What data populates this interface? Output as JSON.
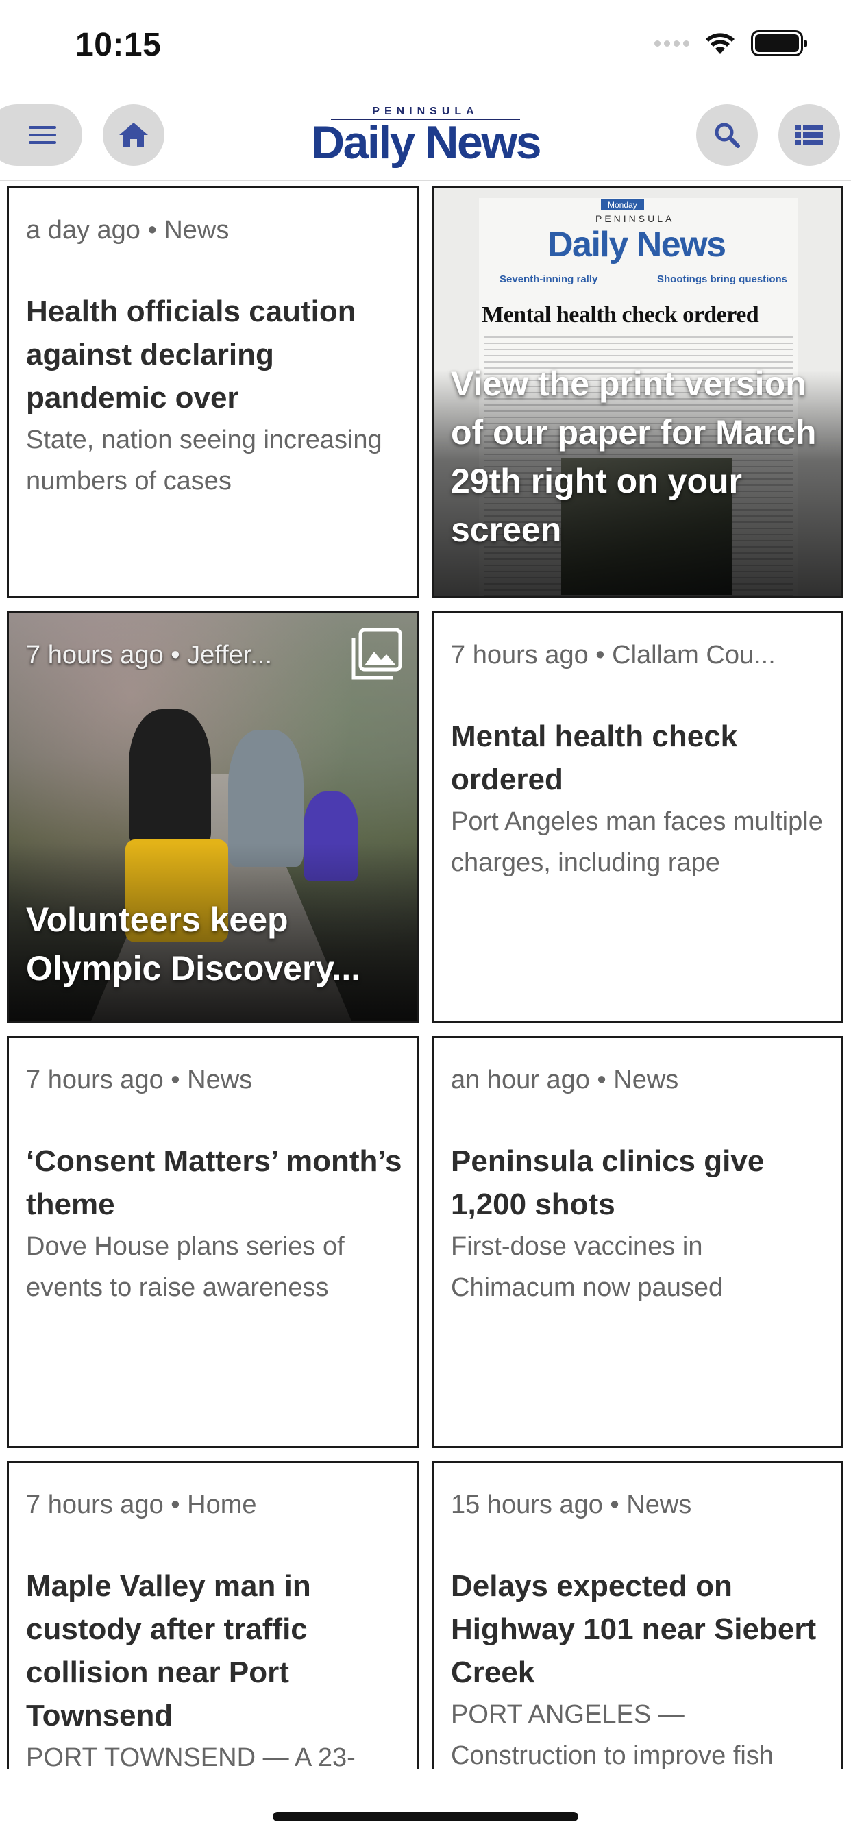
{
  "status_bar": {
    "time": "10:15"
  },
  "header": {
    "logo_top": "PENINSULA",
    "logo_main": "Daily News",
    "menu_icon": "hamburger-menu-icon",
    "home_icon": "home-icon",
    "search_icon": "search-icon",
    "sections_icon": "list-icon"
  },
  "colors": {
    "brand": "#1e3c8c",
    "icon_bg": "#d9d9d9",
    "icon_fg": "#3a4fa0",
    "card_border": "#1a1a1a"
  },
  "cards": [
    {
      "meta": "a day ago • News",
      "headline": "Health officials caution against declaring pandemic over",
      "deck": "State, nation seeing increasing numbers of cases"
    },
    {
      "overlay": "View the print version of our paper for March 29th right on your screen",
      "paper": {
        "kicker": "Monday",
        "sub": "PENINSULA",
        "logo": "Daily News",
        "headline": "Mental health check ordered",
        "teaser_left": "Seventh-inning rally",
        "teaser_right": "Shootings bring questions"
      }
    },
    {
      "meta": "7 hours ago • Jeffer...",
      "overlay": "Volunteers keep Olympic Discovery...",
      "gallery_icon": "photo-gallery-icon"
    },
    {
      "meta": "7 hours ago • Clallam Cou...",
      "headline": "Mental health check ordered",
      "deck": "Port Angeles man faces multiple charges, including rape"
    },
    {
      "meta": "7 hours ago • News",
      "headline": "‘Consent Matters’ month’s theme",
      "deck": "Dove House plans series of events to raise awareness"
    },
    {
      "meta": "an hour ago • News",
      "headline": "Peninsula clinics give 1,200 shots",
      "deck": "First-dose vaccines in Chimacum now paused"
    },
    {
      "meta": "7 hours ago • Home",
      "headline": "Maple Valley man in custody after traffic collision near Port Townsend",
      "deck": "PORT TOWNSEND — A 23-"
    },
    {
      "meta": "15 hours ago • News",
      "headline": "Delays expected on Highway 101 near Siebert Creek",
      "deck": "PORT ANGELES — Construction to improve fish"
    }
  ]
}
